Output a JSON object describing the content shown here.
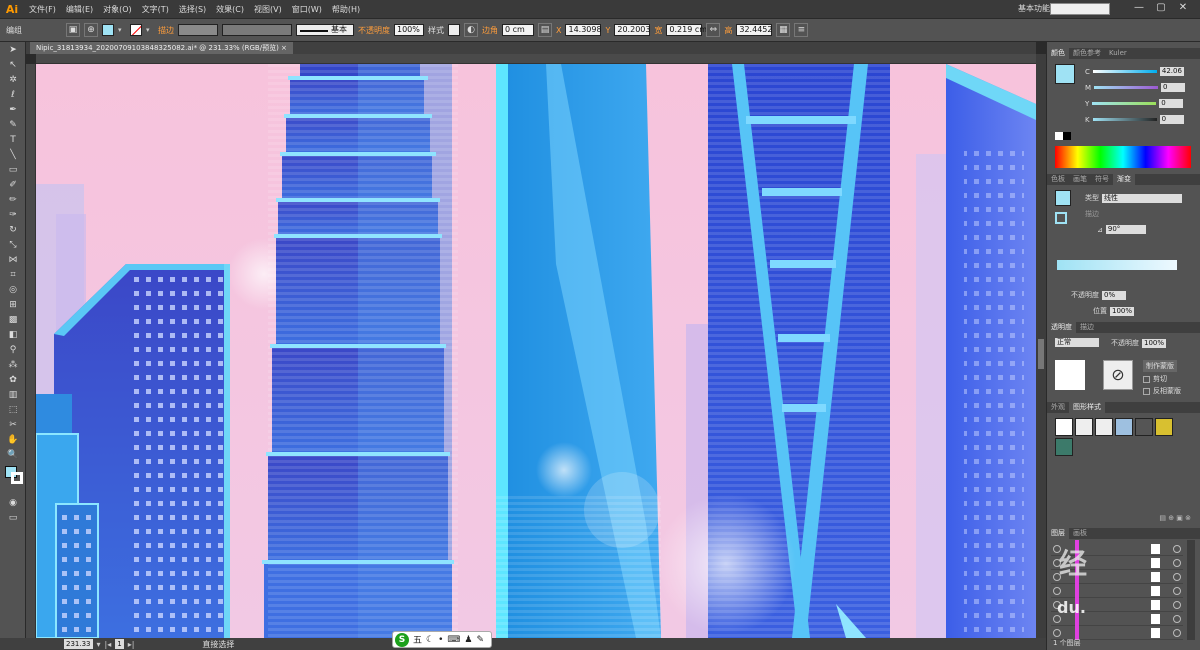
{
  "app": {
    "logo": "Ai",
    "workspace": "基本功能",
    "window_buttons": [
      "—",
      "▢",
      "✕"
    ]
  },
  "menu": [
    "文件(F)",
    "编辑(E)",
    "对象(O)",
    "文字(T)",
    "选择(S)",
    "效果(C)",
    "视图(V)",
    "窗口(W)",
    "帮助(H)"
  ],
  "control": {
    "group_label": "编组",
    "stroke_label": "描边",
    "stroke_style": "基本",
    "opacity_label": "不透明度",
    "opacity_value": "100%",
    "style_label": "样式",
    "corner_label": "边角",
    "corner_value": "0 cm",
    "x_label": "X",
    "x_value": "14.3098",
    "y_label": "Y",
    "y_value": "20.2003",
    "w_label": "宽",
    "w_value": "0.219 cm",
    "h_label": "高",
    "h_value": "32.4452",
    "fill_color": "#9fe2f4"
  },
  "document": {
    "tab": "Nipic_31813934_20200709103848325082.ai* @ 231.33% (RGB/预览)",
    "close": "×"
  },
  "status": {
    "zoom": "231.33",
    "artboard": "1",
    "tool": "直接选择"
  },
  "ime": {
    "logo": "S",
    "text": "五"
  },
  "panels": {
    "color_tabs": [
      "颜色",
      "颜色参考",
      "Kuler"
    ],
    "color_channels": [
      {
        "label": "C",
        "value": "42.06"
      },
      {
        "label": "M",
        "value": "0"
      },
      {
        "label": "Y",
        "value": "0"
      },
      {
        "label": "K",
        "value": "0"
      }
    ],
    "gradient_tabs": [
      "色板",
      "画笔",
      "符号",
      "渐变"
    ],
    "gradient_type_label": "类型",
    "gradient_type": "线性",
    "gradient_stroke_label": "描边",
    "gradient_angle": "90°",
    "gradient_opacity_label": "不透明度",
    "gradient_opacity": "0%",
    "gradient_position_label": "位置",
    "gradient_position": "100%",
    "transparency_tabs": [
      "透明度",
      "描边"
    ],
    "blend_mode": "正常",
    "transparency_opacity_label": "不透明度",
    "transparency_opacity": "100%",
    "make_mask": "制作蒙版",
    "clip": "剪切",
    "invert_mask": "反相蒙版",
    "appearance_tabs": [
      "外观",
      "图形样式"
    ],
    "layers_tabs": [
      "图层",
      "画板"
    ],
    "layers_count": "1 个图层",
    "watermark_text": "经",
    "watermark_text2": "du."
  }
}
